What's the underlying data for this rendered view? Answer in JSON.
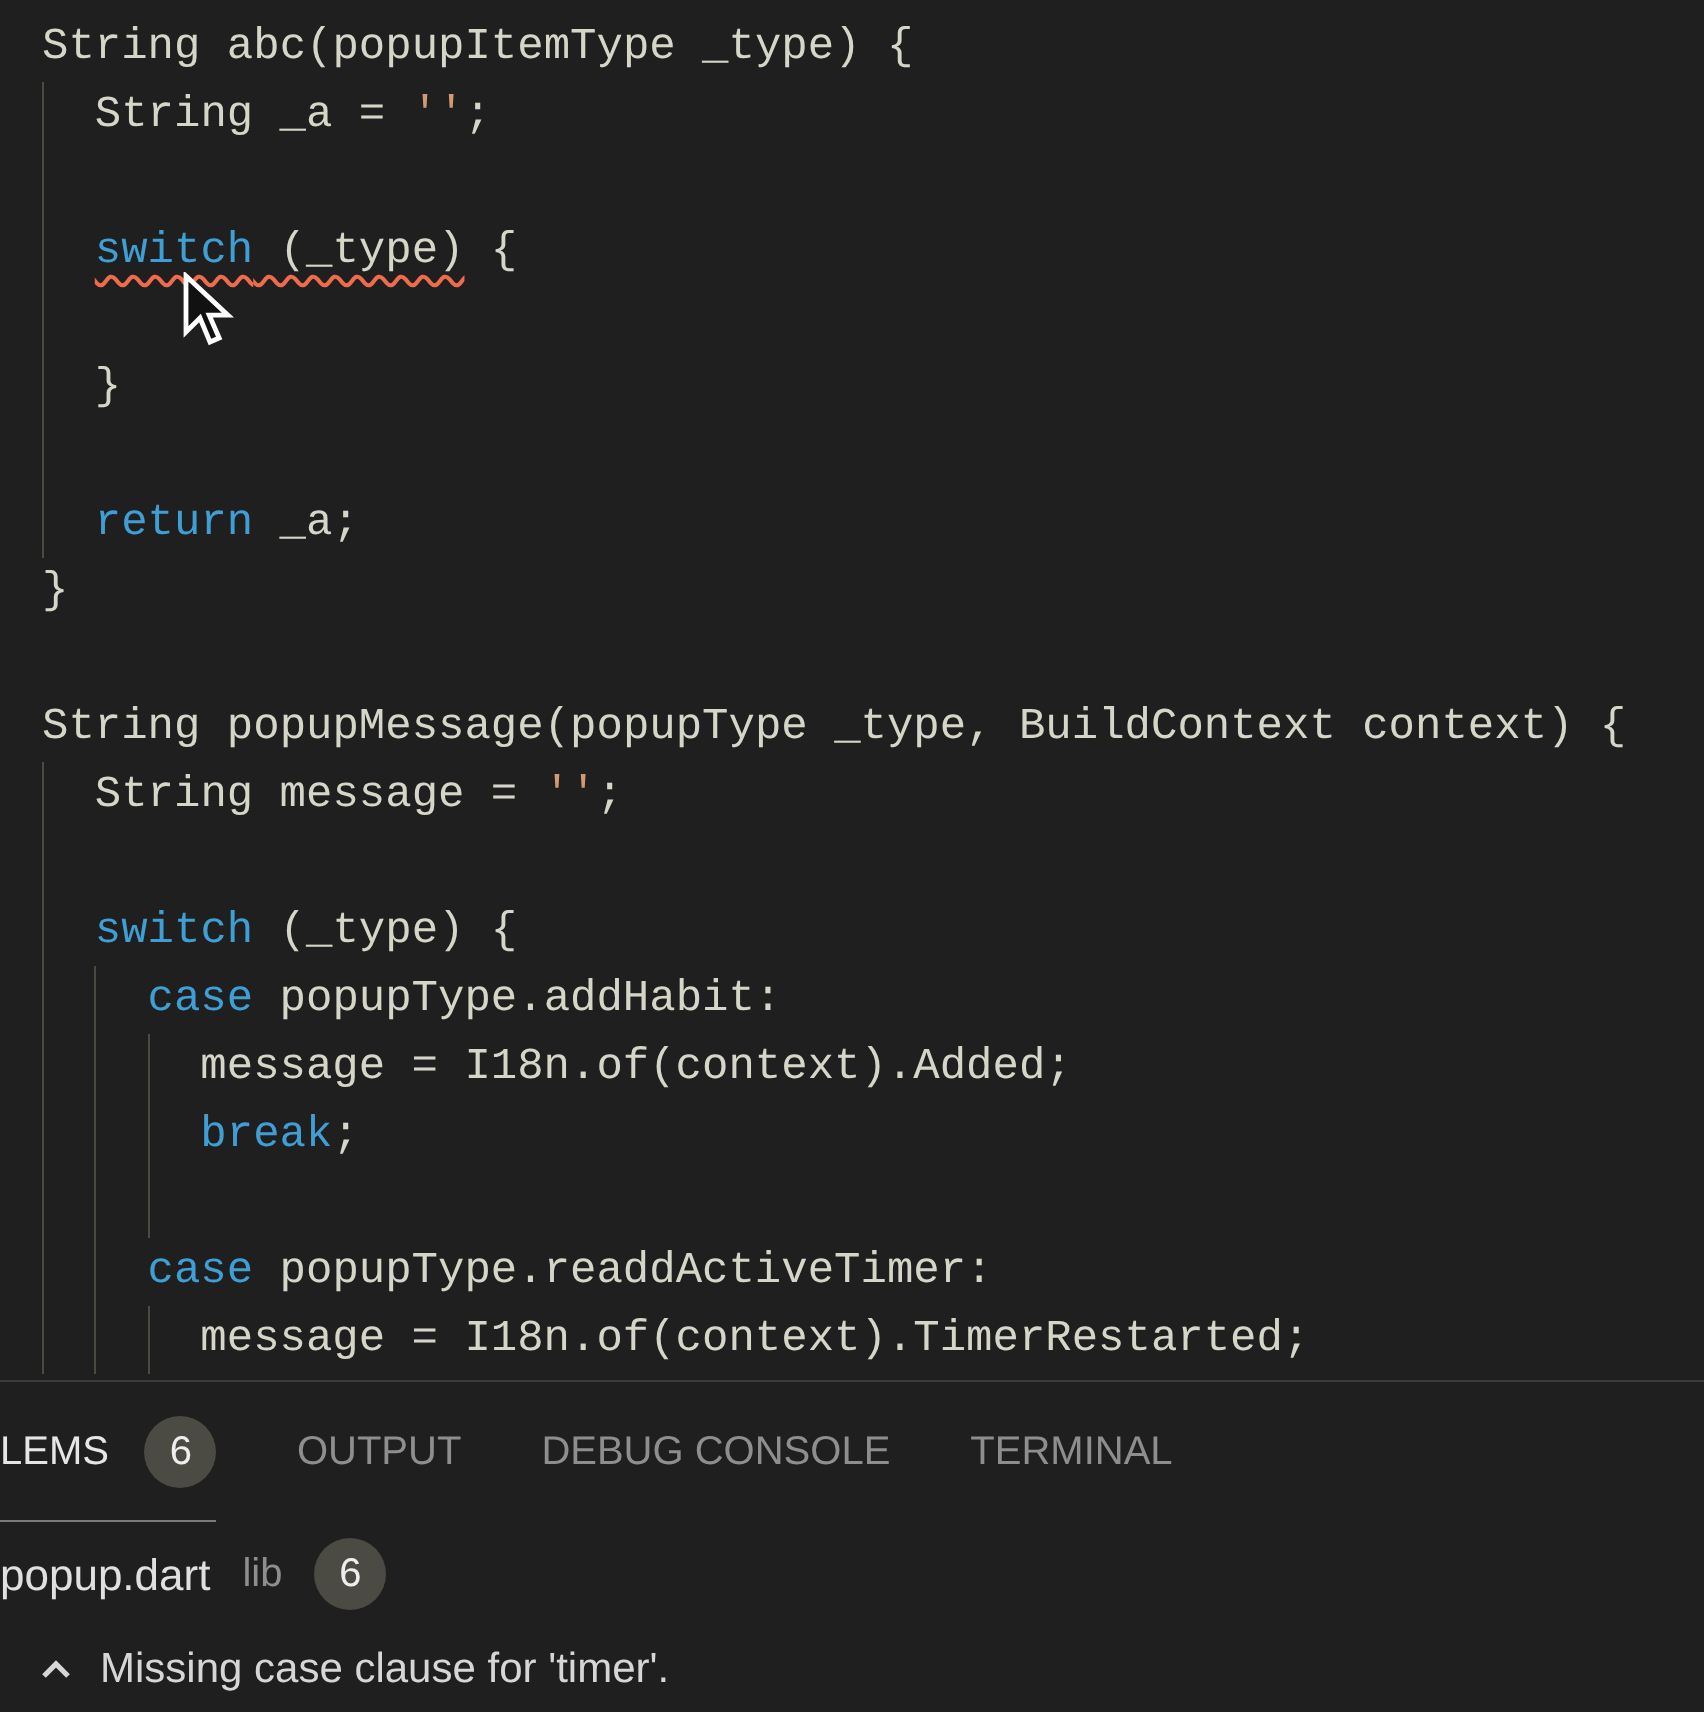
{
  "editor": {
    "lines": [
      {
        "kind": "code",
        "tokens": [
          {
            "kind": "plain",
            "text": "String abc(popupItemType _type) {"
          }
        ]
      },
      {
        "kind": "code",
        "tokens": [
          {
            "kind": "plain",
            "text": "  String _a = "
          },
          {
            "kind": "string",
            "text": "''"
          },
          {
            "kind": "plain",
            "text": ";"
          }
        ]
      },
      {
        "kind": "blank"
      },
      {
        "kind": "code",
        "tokens": [
          {
            "kind": "keyword",
            "text": "  switch",
            "error": true
          },
          {
            "kind": "plain",
            "text": " (_type)",
            "error": true
          },
          {
            "kind": "plain",
            "text": " {"
          }
        ]
      },
      {
        "kind": "blank"
      },
      {
        "kind": "code",
        "tokens": [
          {
            "kind": "plain",
            "text": "  }"
          }
        ]
      },
      {
        "kind": "blank"
      },
      {
        "kind": "code",
        "tokens": [
          {
            "kind": "keyword",
            "text": "  return"
          },
          {
            "kind": "plain",
            "text": " _a;"
          }
        ]
      },
      {
        "kind": "code",
        "tokens": [
          {
            "kind": "plain",
            "text": "}"
          }
        ]
      },
      {
        "kind": "blank"
      },
      {
        "kind": "code",
        "tokens": [
          {
            "kind": "plain",
            "text": "String popupMessage(popupType _type, BuildContext context) {"
          }
        ]
      },
      {
        "kind": "code",
        "tokens": [
          {
            "kind": "plain",
            "text": "  String message = "
          },
          {
            "kind": "string",
            "text": "''"
          },
          {
            "kind": "plain",
            "text": ";"
          }
        ]
      },
      {
        "kind": "blank"
      },
      {
        "kind": "code",
        "tokens": [
          {
            "kind": "keyword",
            "text": "  switch"
          },
          {
            "kind": "plain",
            "text": " (_type) {"
          }
        ]
      },
      {
        "kind": "code",
        "tokens": [
          {
            "kind": "keyword",
            "text": "    case"
          },
          {
            "kind": "plain",
            "text": " popupType.addHabit:"
          }
        ]
      },
      {
        "kind": "code",
        "tokens": [
          {
            "kind": "plain",
            "text": "      message = I18n.of(context).Added;"
          }
        ]
      },
      {
        "kind": "code",
        "tokens": [
          {
            "kind": "keyword",
            "text": "      break"
          },
          {
            "kind": "plain",
            "text": ";"
          }
        ]
      },
      {
        "kind": "blank"
      },
      {
        "kind": "code",
        "tokens": [
          {
            "kind": "keyword",
            "text": "    case"
          },
          {
            "kind": "plain",
            "text": " popupType.readdActiveTimer:"
          }
        ]
      },
      {
        "kind": "code",
        "tokens": [
          {
            "kind": "plain",
            "text": "      message = I18n.of(context).TimerRestarted;"
          }
        ]
      }
    ]
  },
  "panel": {
    "tabs": [
      {
        "label": "LEMS",
        "selected": true,
        "badge": "6"
      },
      {
        "label": "OUTPUT",
        "selected": false
      },
      {
        "label": "DEBUG CONSOLE",
        "selected": false
      },
      {
        "label": "TERMINAL",
        "selected": false
      }
    ],
    "file": {
      "name": "popup.dart",
      "folder": "lib",
      "count": "6"
    },
    "problems": [
      {
        "message": "Missing case clause for 'timer'."
      }
    ]
  }
}
